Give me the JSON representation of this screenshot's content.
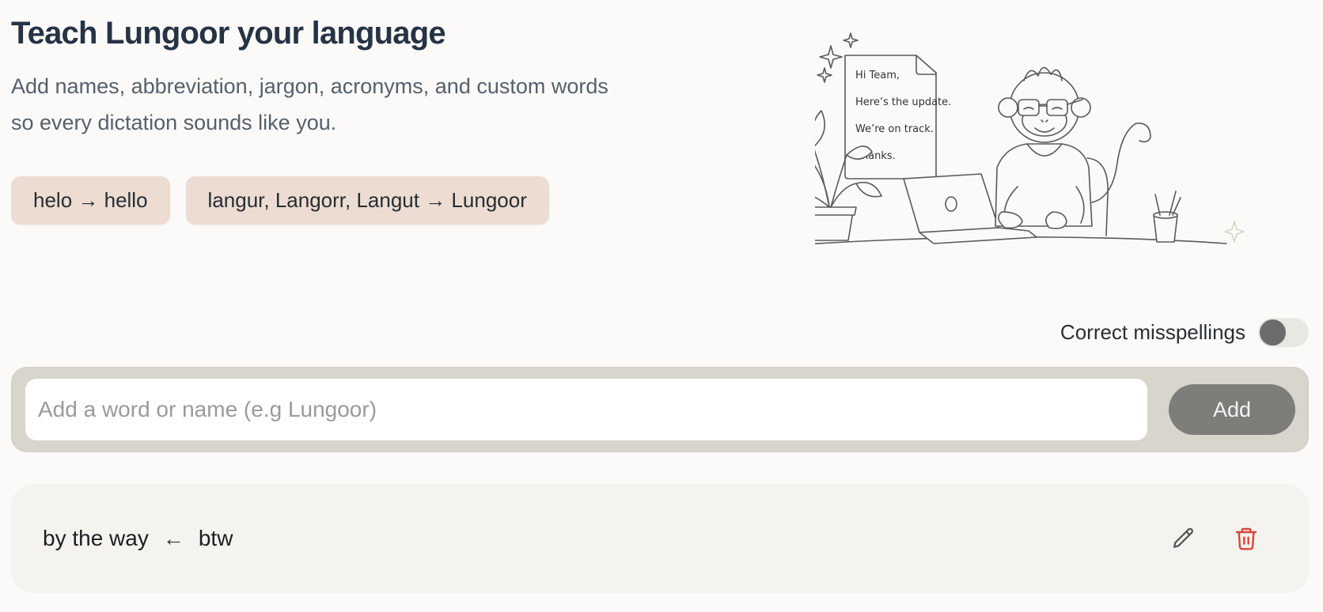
{
  "hero": {
    "title": "Teach Lungoor your language",
    "subtitle": "Add names, abbreviation, jargon, acronyms, and custom words so every dictation sounds like you.",
    "examples": [
      "helo → hello",
      "langur, Langorr, Langut → Lungoor"
    ],
    "note": {
      "lines": [
        "Hi Team,",
        "Here’s the update.",
        "We’re on track.",
        "Thanks."
      ]
    }
  },
  "settings": {
    "correct_misspellings_label": "Correct misspellings",
    "correct_misspellings_enabled": false
  },
  "add_form": {
    "input_value": "",
    "placeholder": "Add a word or name (e.g Lungoor)",
    "button_label": "Add"
  },
  "entries": [
    {
      "replacement": "by the way",
      "arrow": "←",
      "original": "btw"
    }
  ],
  "colors": {
    "background": "#fbfaf8",
    "chip": "#ecdcd2",
    "panel": "#d8d5cc",
    "add_button": "#7d7d79",
    "delete": "#d9453a"
  },
  "icons": {
    "edit": "pencil-icon",
    "delete": "trash-icon"
  }
}
